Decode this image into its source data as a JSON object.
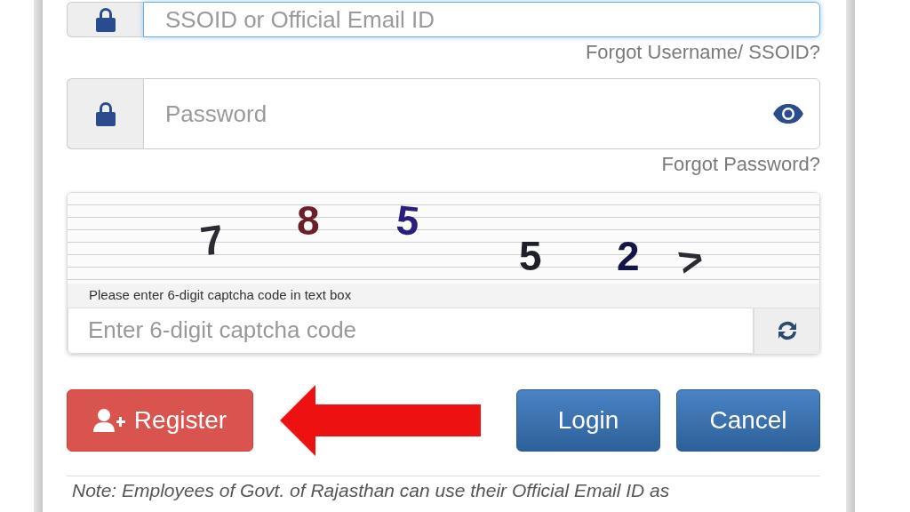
{
  "username": {
    "placeholder": "SSOID or Official Email ID",
    "focused": true
  },
  "forgot_username": "Forgot Username/ SSOID?",
  "password": {
    "placeholder": "Password"
  },
  "forgot_password": "Forgot Password?",
  "captcha": {
    "characters": [
      {
        "char": "7",
        "color": "#2b2b33"
      },
      {
        "char": "8",
        "color": "#6b1f2a"
      },
      {
        "char": "5",
        "color": "#2a1f7a"
      },
      {
        "char": "5",
        "color": "#1f1f2a"
      },
      {
        "char": "2",
        "color": "#141446"
      },
      {
        "char": ">",
        "color": "#2b2b33"
      }
    ],
    "caption": "Please enter 6-digit captcha code in text box",
    "placeholder": "Enter 6-digit captcha code"
  },
  "buttons": [
    {
      "kind": "register",
      "label": "Register"
    },
    {
      "kind": "arrow"
    },
    {
      "kind": "primary",
      "label": "Login"
    },
    {
      "kind": "primary",
      "label": "Cancel"
    }
  ],
  "note": "Note: Employees of Govt. of Rajasthan can use their Official Email ID as"
}
